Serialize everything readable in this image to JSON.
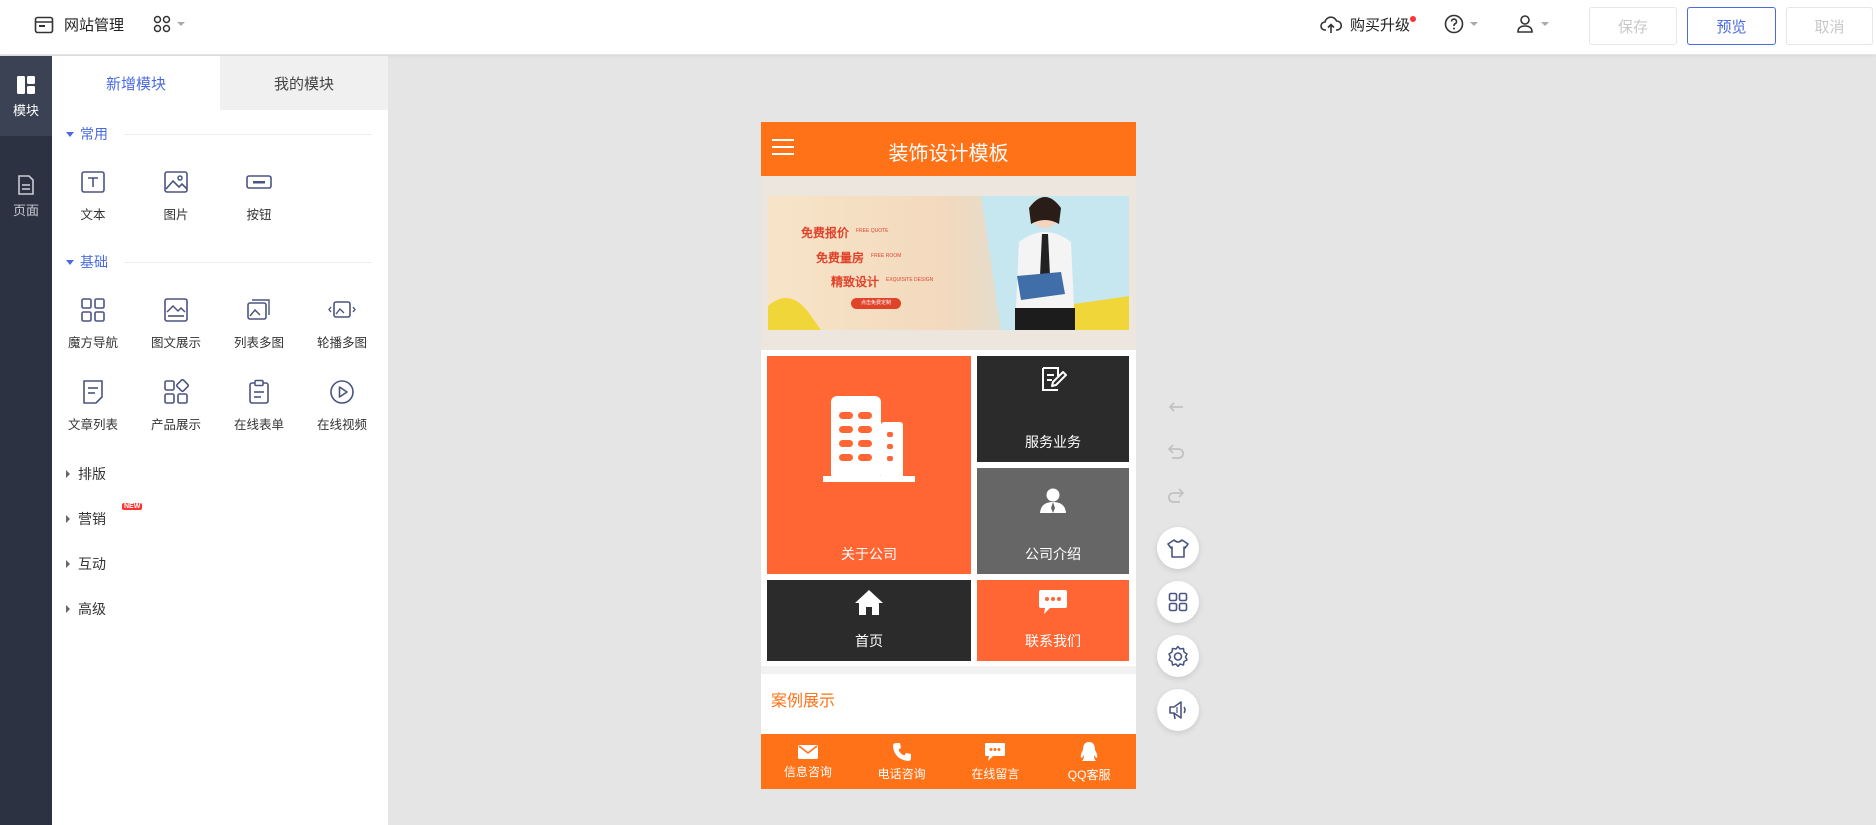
{
  "topbar": {
    "site_manage": "网站管理",
    "upgrade": "购买升级",
    "save": "保存",
    "preview": "预览",
    "cancel": "取消"
  },
  "rail": {
    "modules": "模块",
    "pages": "页面"
  },
  "panel": {
    "tabs": [
      "新增模块",
      "我的模块"
    ],
    "sections": {
      "common": "常用",
      "basic": "基础",
      "layout": "排版",
      "marketing": "营销",
      "interaction": "互动",
      "advanced": "高级"
    },
    "new_badge": "NEW",
    "common_items": [
      "文本",
      "图片",
      "按钮"
    ],
    "basic_items": [
      "魔方导航",
      "图文展示",
      "列表多图",
      "轮播多图",
      "文章列表",
      "产品展示",
      "在线表单",
      "在线视频"
    ]
  },
  "phone": {
    "title": "装饰设计模板",
    "banner": {
      "line1": "免费报价",
      "line1_sub": "FREE QUOTE",
      "line2": "免费量房",
      "line2_sub": "FREE ROOM",
      "line3": "精致设计",
      "line3_sub": "EXQUISITE DESIGN",
      "cta": "点击免费定制"
    },
    "tiles": {
      "about": "关于公司",
      "service": "服务业务",
      "intro": "公司介绍",
      "home": "首页",
      "contact": "联系我们"
    },
    "case_title": "案例展示",
    "footer": [
      "信息咨询",
      "电话咨询",
      "在线留言",
      "QQ客服"
    ]
  },
  "colors": {
    "accent": "#4a6be0",
    "brand_orange": "#ff7218",
    "tile_orange": "#ff6633",
    "tile_dark": "#2b2b2b",
    "tile_gray": "#666666"
  }
}
